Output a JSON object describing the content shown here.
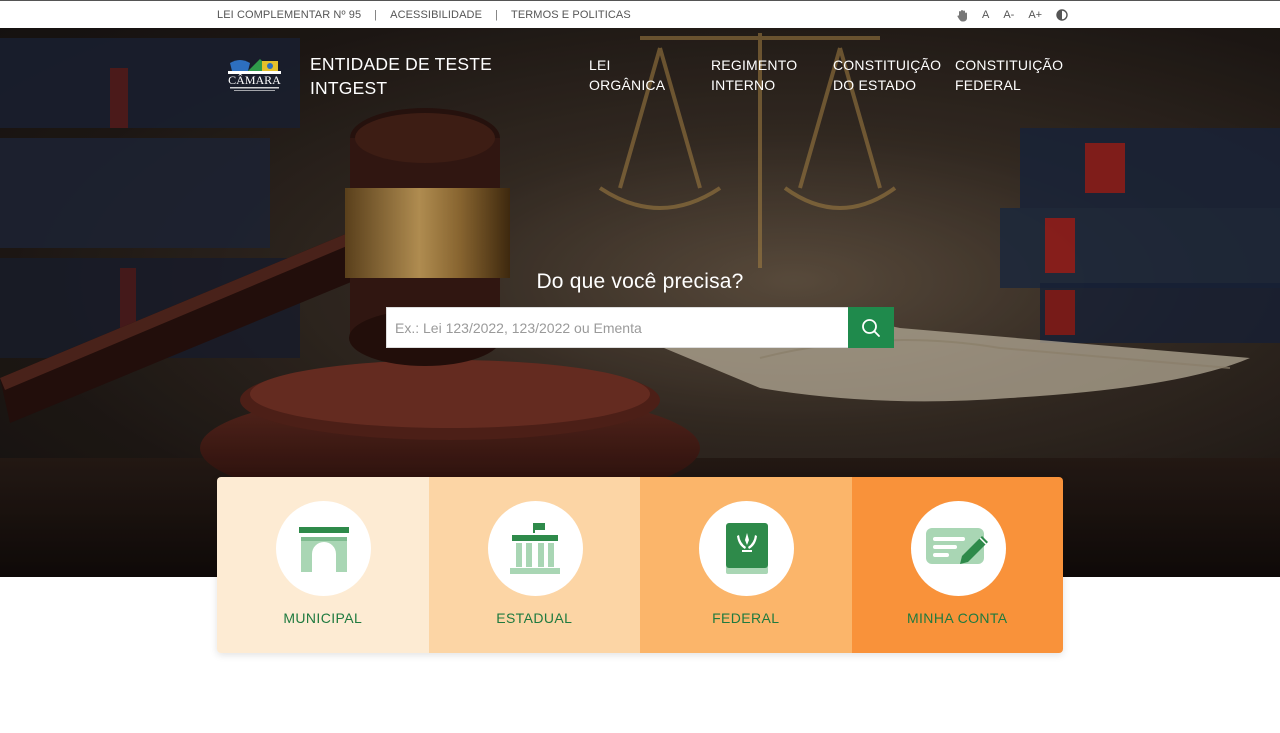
{
  "topbar": {
    "links": [
      "LEI COMPLEMENTAR Nº 95",
      "ACESSIBILIDADE",
      "TERMOS E POLITICAS"
    ],
    "separator": "|",
    "a11y": {
      "libras_icon": "hand-icon",
      "font_normal": "A",
      "font_decrease": "A-",
      "font_increase": "A+",
      "contrast_icon": "contrast-icon"
    }
  },
  "header": {
    "logo_text": "CÂMARA",
    "title_line1": "ENTIDADE DE TESTE",
    "title_line2": "INTGEST",
    "nav": [
      {
        "line1": "LEI",
        "line2": "ORGÂNICA"
      },
      {
        "line1": "REGIMENTO",
        "line2": "INTERNO"
      },
      {
        "line1": "CONSTITUIÇÃO",
        "line2": "DO ESTADO"
      },
      {
        "line1": "CONSTITUIÇÃO",
        "line2": "FEDERAL"
      }
    ]
  },
  "search": {
    "heading": "Do que você precisa?",
    "placeholder": "Ex.: Lei 123/2022, 123/2022 ou Ementa",
    "value": "",
    "button_icon": "search-icon"
  },
  "cards": [
    {
      "label": "MUNICIPAL",
      "icon": "city-gate-icon",
      "bg": "#fdebd3"
    },
    {
      "label": "ESTADUAL",
      "icon": "government-building-icon",
      "bg": "#fcd5a5"
    },
    {
      "label": "FEDERAL",
      "icon": "law-book-icon",
      "bg": "#fbb56a"
    },
    {
      "label": "MINHA CONTA",
      "icon": "edit-document-icon",
      "bg": "#f9923a"
    }
  ],
  "colors": {
    "accent_green": "#1f8a4c",
    "label_green": "#1f7a3f",
    "icon_green": "#2e8a4a",
    "icon_light_green": "#a9d6b4"
  }
}
